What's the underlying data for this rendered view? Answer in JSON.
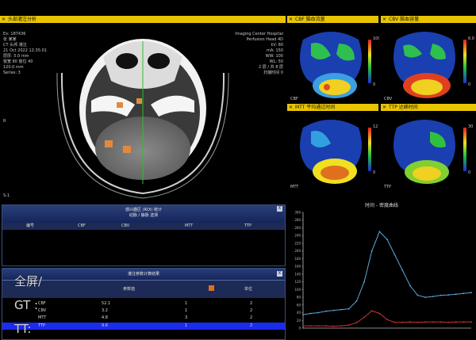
{
  "main_view": {
    "title": "头部灌注分析",
    "patient_info": [
      "Ex: 187436",
      "张 某某",
      "CT 头颅 灌注",
      "21 Oct 2022 12:35:01",
      "层厚: 5.0 mm",
      "窗宽 80  窗位 40",
      "120.0 mm",
      "Series: 3"
    ],
    "hospital_info": [
      "Imaging Center Hospital",
      "Perfusion  Head 4D",
      "kV: 80",
      "mA: 150",
      "WW: 100",
      "WL: 50",
      "2 层 / 共 8 层",
      "扫描时间 0"
    ],
    "side_label": "R",
    "left_label": "S-1"
  },
  "maps": [
    {
      "title": "CBF 脑血流量",
      "scale_top": "100",
      "scale_bottom": "0",
      "label": "CBF"
    },
    {
      "title": "CBV 脑血容量",
      "scale_top": "6.0",
      "scale_bottom": "0",
      "label": "CBV"
    },
    {
      "title": "MTT 平均通过时间",
      "scale_top": "12",
      "scale_bottom": "0",
      "label": "MTT"
    },
    {
      "title": "TTP 达峰时间",
      "scale_top": "30",
      "scale_bottom": "0",
      "label": "TTP"
    }
  ],
  "roi_panel": {
    "header_line1": "感兴趣区 (ROI) 统计",
    "header_line2": "动脉 / 静脉 选择",
    "close_label": "X",
    "columns": [
      "编号",
      "CBF",
      "CBV",
      "MTT",
      "TTP"
    ]
  },
  "result_panel": {
    "header": "灌注参数计算结果",
    "close_label": "X",
    "col_header": "参数值",
    "col_header2": "单位",
    "rows": [
      {
        "name": "CBF",
        "value": "52.1",
        "n": "1",
        "u": "2"
      },
      {
        "name": "CBV",
        "value": "3.2",
        "n": "1",
        "u": "2"
      },
      {
        "name": "MTT",
        "value": "4.8",
        "n": "3",
        "u": "2"
      },
      {
        "name": "TTP",
        "value": "9.6",
        "n": "1",
        "u": "2"
      }
    ]
  },
  "overlay": {
    "line1": "全屏/",
    "line2": "GT :",
    "line3": "TT:"
  },
  "chart_data": {
    "type": "line",
    "title": "时间 - 密度曲线",
    "xlabel": "",
    "ylabel": "",
    "x": [
      0,
      2,
      4,
      6,
      8,
      10,
      12,
      14,
      16,
      18,
      20,
      22,
      24,
      26,
      28,
      30,
      32,
      34,
      36,
      38,
      40,
      42,
      44
    ],
    "ylim": [
      0,
      300
    ],
    "xlim": [
      0,
      44
    ],
    "y_ticks": [
      "300",
      "280",
      "260",
      "240",
      "220",
      "200",
      "180",
      "160",
      "140",
      "120",
      "100",
      "80",
      "60",
      "40",
      "20",
      "0"
    ],
    "series": [
      {
        "name": "",
        "color": "#5aa8d8",
        "values": [
          35,
          38,
          40,
          44,
          46,
          48,
          50,
          70,
          120,
          200,
          250,
          230,
          190,
          150,
          110,
          85,
          80,
          82,
          85,
          86,
          88,
          90,
          92
        ]
      },
      {
        "name": "",
        "color": "#d03030",
        "values": [
          6,
          6,
          6,
          6,
          5,
          6,
          8,
          14,
          28,
          45,
          38,
          22,
          15,
          15,
          16,
          15,
          16,
          16,
          16,
          15,
          16,
          16,
          16
        ]
      }
    ]
  }
}
